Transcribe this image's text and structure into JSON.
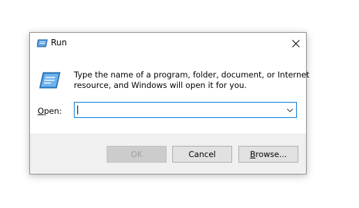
{
  "window": {
    "title": "Run",
    "icon": "run-icon"
  },
  "prompt": {
    "line1": "Type the name of a program, folder, document, or Internet",
    "line2": "resource, and Windows will open it for you."
  },
  "open_field": {
    "label_underlined": "O",
    "label_rest": "pen:",
    "value": ""
  },
  "buttons": {
    "ok": "OK",
    "cancel": "Cancel",
    "browse_underlined": "B",
    "browse_rest": "rowse..."
  },
  "colors": {
    "focus_border": "#0078d7",
    "footer_bg": "#f0f0f0",
    "button_bg": "#e1e1e1"
  }
}
